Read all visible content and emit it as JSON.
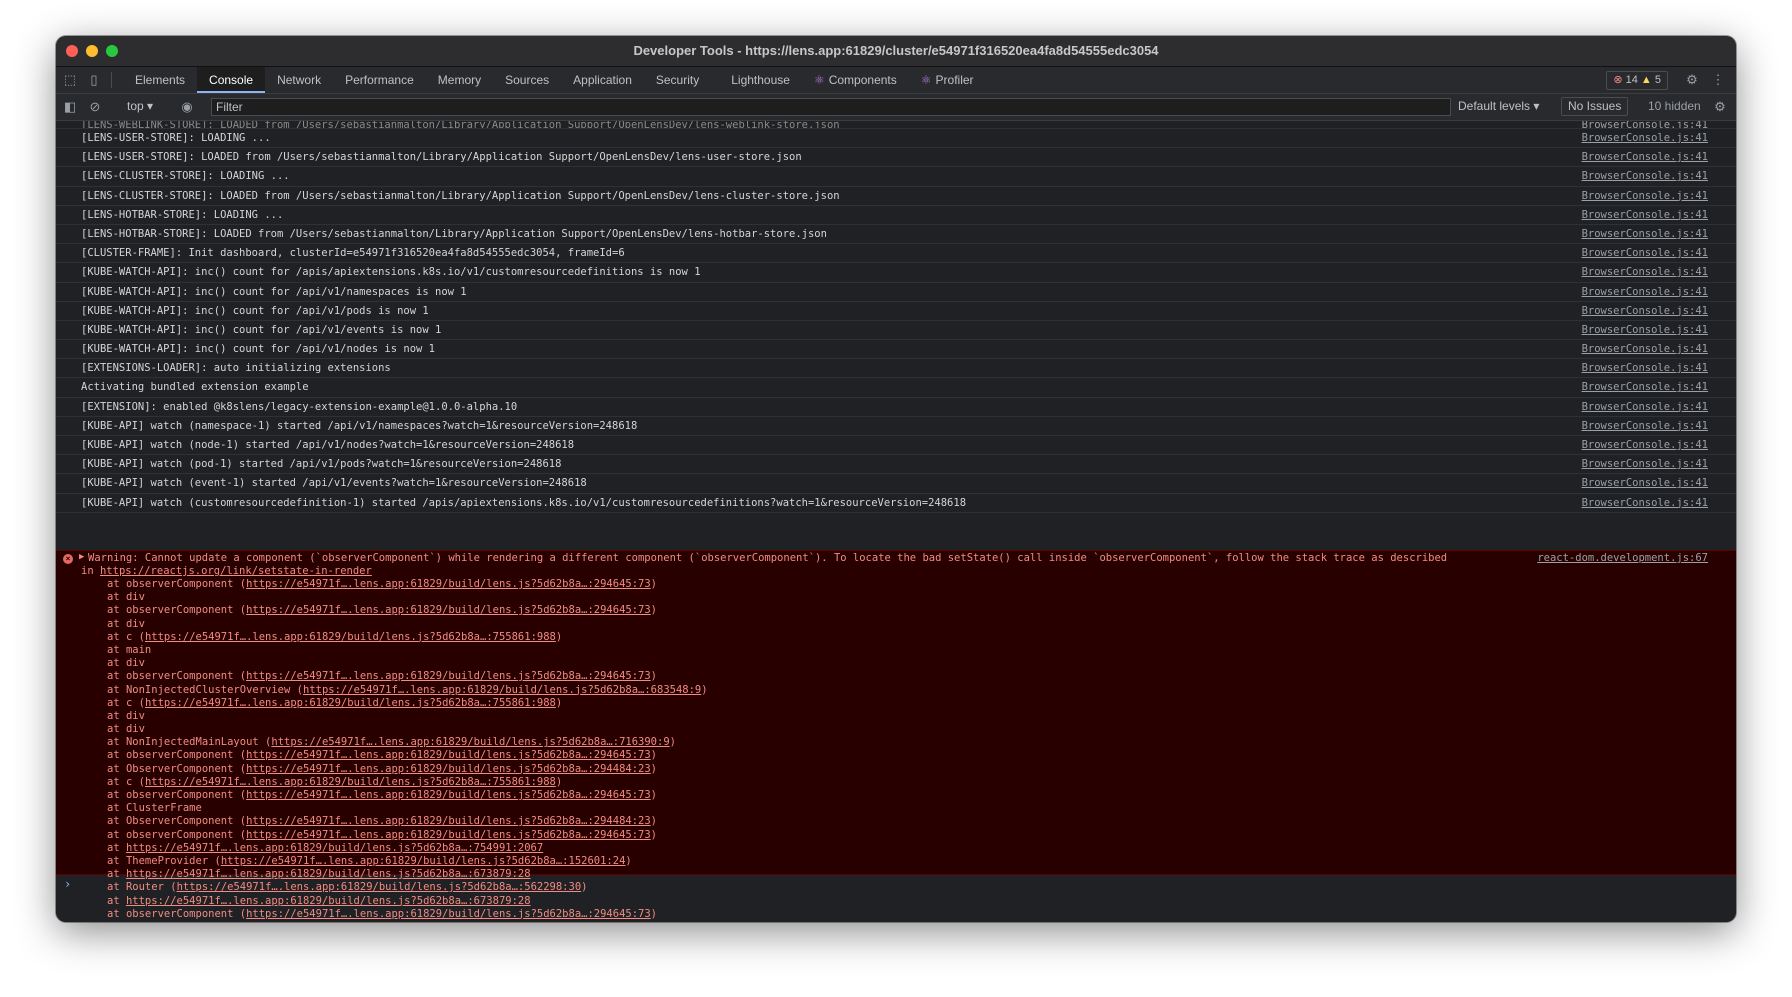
{
  "window": {
    "title": "Developer Tools - https://lens.app:61829/cluster/e54971f316520ea4fa8d54555edc3054",
    "traffic_lights": [
      "#ff5f57",
      "#febc2e",
      "#28c840"
    ]
  },
  "tabs": [
    {
      "label": "Elements"
    },
    {
      "label": "Console",
      "active": true
    },
    {
      "label": "Network"
    },
    {
      "label": "Performance"
    },
    {
      "label": "Memory"
    },
    {
      "label": "Sources"
    },
    {
      "label": "Application"
    },
    {
      "label": "Security"
    },
    {
      "label": "Lighthouse"
    },
    {
      "label": "Components",
      "icon": "react-icon"
    },
    {
      "label": "Profiler",
      "icon": "react-icon"
    }
  ],
  "counts": {
    "errors": "14",
    "warnings": "5"
  },
  "toolbar": {
    "context": "top",
    "filter_placeholder": "Filter",
    "levels": "Default levels",
    "issues": "No Issues",
    "hidden": "10 hidden"
  },
  "logs": [
    {
      "text": "[LENS-WEBLINK-STORE]: LOADED from /Users/sebastianmalton/Library/Application Support/OpenLensDev/lens-weblink-store.json",
      "src": "BrowserConsole.js:41"
    },
    {
      "text": "[LENS-USER-STORE]: LOADING ...",
      "src": "BrowserConsole.js:41"
    },
    {
      "text": "[LENS-USER-STORE]: LOADED from /Users/sebastianmalton/Library/Application Support/OpenLensDev/lens-user-store.json",
      "src": "BrowserConsole.js:41"
    },
    {
      "text": "[LENS-CLUSTER-STORE]: LOADING ...",
      "src": "BrowserConsole.js:41"
    },
    {
      "text": "[LENS-CLUSTER-STORE]: LOADED from /Users/sebastianmalton/Library/Application Support/OpenLensDev/lens-cluster-store.json",
      "src": "BrowserConsole.js:41"
    },
    {
      "text": "[LENS-HOTBAR-STORE]: LOADING ...",
      "src": "BrowserConsole.js:41"
    },
    {
      "text": "[LENS-HOTBAR-STORE]: LOADED from /Users/sebastianmalton/Library/Application Support/OpenLensDev/lens-hotbar-store.json",
      "src": "BrowserConsole.js:41"
    },
    {
      "text": "[CLUSTER-FRAME]: Init dashboard, clusterId=e54971f316520ea4fa8d54555edc3054, frameId=6",
      "src": "BrowserConsole.js:41"
    },
    {
      "text": "[KUBE-WATCH-API]: inc() count for /apis/apiextensions.k8s.io/v1/customresourcedefinitions is now 1",
      "src": "BrowserConsole.js:41"
    },
    {
      "text": "[KUBE-WATCH-API]: inc() count for /api/v1/namespaces is now 1",
      "src": "BrowserConsole.js:41"
    },
    {
      "text": "[KUBE-WATCH-API]: inc() count for /api/v1/pods is now 1",
      "src": "BrowserConsole.js:41"
    },
    {
      "text": "[KUBE-WATCH-API]: inc() count for /api/v1/events is now 1",
      "src": "BrowserConsole.js:41"
    },
    {
      "text": "[KUBE-WATCH-API]: inc() count for /api/v1/nodes is now 1",
      "src": "BrowserConsole.js:41"
    },
    {
      "text": "[EXTENSIONS-LOADER]: auto initializing extensions",
      "src": "BrowserConsole.js:41"
    },
    {
      "text": "Activating bundled extension example",
      "src": "BrowserConsole.js:41"
    },
    {
      "text": "[EXTENSION]: enabled @k8slens/legacy-extension-example@1.0.0-alpha.10",
      "src": "BrowserConsole.js:41"
    },
    {
      "text": "[KUBE-API] watch (namespace-1) started /api/v1/namespaces?watch=1&resourceVersion=248618",
      "src": "BrowserConsole.js:41"
    },
    {
      "text": "[KUBE-API] watch (node-1) started /api/v1/nodes?watch=1&resourceVersion=248618",
      "src": "BrowserConsole.js:41"
    },
    {
      "text": "[KUBE-API] watch (pod-1) started /api/v1/pods?watch=1&resourceVersion=248618",
      "src": "BrowserConsole.js:41"
    },
    {
      "text": "[KUBE-API] watch (event-1) started /api/v1/events?watch=1&resourceVersion=248618",
      "src": "BrowserConsole.js:41"
    },
    {
      "text": "[KUBE-API] watch (customresourcedefinition-1) started /apis/apiextensions.k8s.io/v1/customresourcedefinitions?watch=1&resourceVersion=248618",
      "src": "BrowserConsole.js:41"
    }
  ],
  "error": {
    "message": "Warning: Cannot update a component (`observerComponent`) while rendering a different component (`observerComponent`). To locate the bad setState() call inside `observerComponent`, follow the stack trace as described",
    "in_prefix": "in",
    "link": "https://reactjs.org/link/setstate-in-render",
    "src": "react-dom.development.js:67",
    "stack": [
      {
        "name": "observerComponent",
        "url": "https://e54971f….lens.app:61829/build/lens.js?5d62b8a…:294645:73"
      },
      {
        "name": "div",
        "url": ""
      },
      {
        "name": "observerComponent",
        "url": "https://e54971f….lens.app:61829/build/lens.js?5d62b8a…:294645:73"
      },
      {
        "name": "div",
        "url": ""
      },
      {
        "name": "c",
        "url": "https://e54971f….lens.app:61829/build/lens.js?5d62b8a…:755861:988"
      },
      {
        "name": "main",
        "url": ""
      },
      {
        "name": "div",
        "url": ""
      },
      {
        "name": "observerComponent",
        "url": "https://e54971f….lens.app:61829/build/lens.js?5d62b8a…:294645:73"
      },
      {
        "name": "NonInjectedClusterOverview",
        "url": "https://e54971f….lens.app:61829/build/lens.js?5d62b8a…:683548:9"
      },
      {
        "name": "c",
        "url": "https://e54971f….lens.app:61829/build/lens.js?5d62b8a…:755861:988"
      },
      {
        "name": "div",
        "url": ""
      },
      {
        "name": "div",
        "url": ""
      },
      {
        "name": "NonInjectedMainLayout",
        "url": "https://e54971f….lens.app:61829/build/lens.js?5d62b8a…:716390:9"
      },
      {
        "name": "observerComponent",
        "url": "https://e54971f….lens.app:61829/build/lens.js?5d62b8a…:294645:73"
      },
      {
        "name": "ObserverComponent",
        "url": "https://e54971f….lens.app:61829/build/lens.js?5d62b8a…:294484:23"
      },
      {
        "name": "c",
        "url": "https://e54971f….lens.app:61829/build/lens.js?5d62b8a…:755861:988"
      },
      {
        "name": "observerComponent",
        "url": "https://e54971f….lens.app:61829/build/lens.js?5d62b8a…:294645:73"
      },
      {
        "name": "ClusterFrame",
        "url": ""
      },
      {
        "name": "ObserverComponent",
        "url": "https://e54971f….lens.app:61829/build/lens.js?5d62b8a…:294484:23"
      },
      {
        "name": "observerComponent",
        "url": "https://e54971f….lens.app:61829/build/lens.js?5d62b8a…:294645:73"
      },
      {
        "name": "",
        "url": "https://e54971f….lens.app:61829/build/lens.js?5d62b8a…:754991:2067"
      },
      {
        "name": "ThemeProvider",
        "url": "https://e54971f….lens.app:61829/build/lens.js?5d62b8a…:152601:24"
      },
      {
        "name": "",
        "url": "https://e54971f….lens.app:61829/build/lens.js?5d62b8a…:673879:28"
      },
      {
        "name": "Router",
        "url": "https://e54971f….lens.app:61829/build/lens.js?5d62b8a…:562298:30"
      },
      {
        "name": "",
        "url": "https://e54971f….lens.app:61829/build/lens.js?5d62b8a…:673879:28"
      },
      {
        "name": "observerComponent",
        "url": "https://e54971f….lens.app:61829/build/lens.js?5d62b8a…:294645:73"
      }
    ]
  },
  "prompt": "›"
}
